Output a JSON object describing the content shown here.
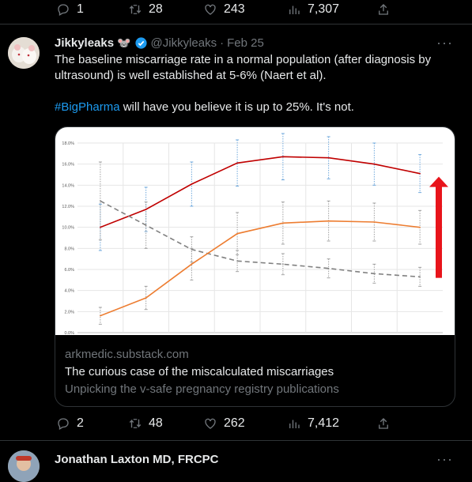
{
  "prev_actions": {
    "replies": "1",
    "retweets": "28",
    "likes": "243",
    "views": "7,307"
  },
  "tweet": {
    "author": "Jikkyleaks",
    "emoji": "🐭",
    "handle": "@Jikkyleaks",
    "date": "Feb 25",
    "text1": "The baseline miscarriage rate in a normal population (after diagnosis by ultrasound) is well established at 5-6% (Naert et al).",
    "hashtag": "#BigPharma",
    "text2": " will have you believe it is up to 25%. It's not.",
    "card": {
      "domain": "arkmedic.substack.com",
      "title": "The curious case of the miscalculated miscarriages",
      "description": "Unpicking the v-safe pregnancy registry publications"
    },
    "actions": {
      "replies": "2",
      "retweets": "48",
      "likes": "262",
      "views": "7,412"
    }
  },
  "next_tweet": {
    "author": "Jonathan Laxton MD, FRCPC"
  },
  "chart_data": {
    "type": "line",
    "title": "",
    "xlabel": "",
    "ylabel": "",
    "ylim": [
      0,
      18
    ],
    "y_ticks": [
      "0.0%",
      "2.0%",
      "4.0%",
      "6.0%",
      "8.0%",
      "10.0%",
      "12.0%",
      "14.0%",
      "16.0%",
      "18.0%"
    ],
    "x": [
      1,
      2,
      3,
      4,
      5,
      6,
      7,
      8
    ],
    "series": [
      {
        "color": "#c00000",
        "style": "solid",
        "values": [
          10.0,
          11.7,
          14.1,
          16.1,
          16.7,
          16.6,
          16.0,
          15.1
        ],
        "err": [
          2.2,
          2.1,
          2.1,
          2.2,
          2.2,
          2.0,
          2.0,
          1.8
        ]
      },
      {
        "color": "#808080",
        "style": "dashed",
        "values": [
          12.5,
          10.2,
          7.9,
          6.8,
          6.5,
          6.1,
          5.6,
          5.3
        ],
        "err": [
          3.7,
          2.2,
          1.2,
          1.0,
          1.0,
          0.9,
          0.9,
          0.9
        ]
      },
      {
        "color": "#ed7d31",
        "style": "solid",
        "values": [
          1.6,
          3.3,
          6.5,
          9.4,
          10.4,
          10.6,
          10.5,
          10.0
        ],
        "err": [
          0.8,
          1.1,
          1.5,
          2.0,
          2.0,
          1.9,
          1.8,
          1.6
        ]
      }
    ],
    "annotation": {
      "type": "red-up-arrow",
      "color": "#e8141b"
    }
  }
}
